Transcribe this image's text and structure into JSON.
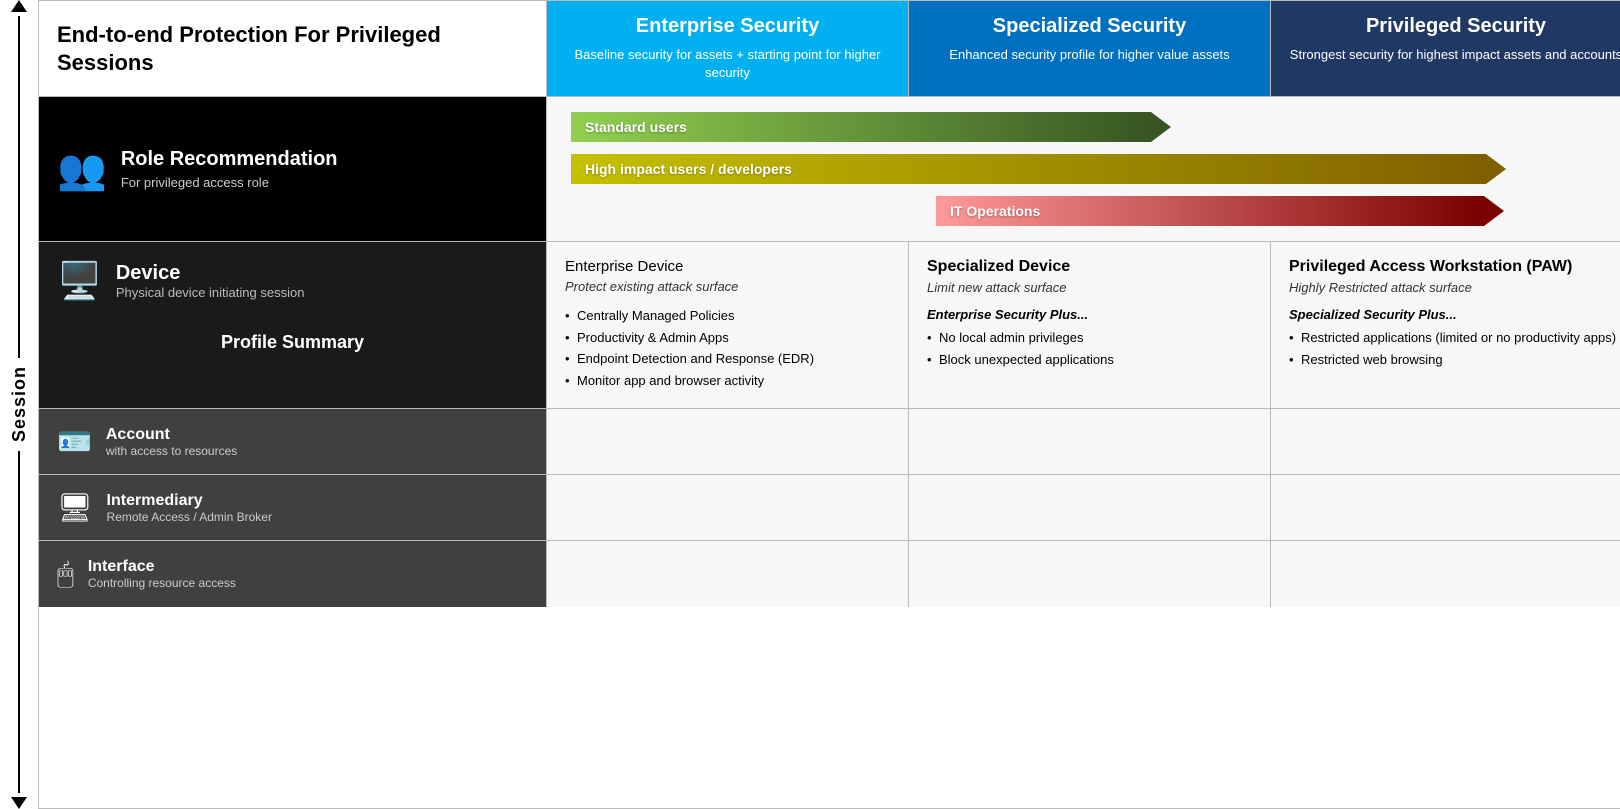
{
  "page": {
    "title": "End-to-end Protection For Privileged Sessions",
    "session_label": "Session"
  },
  "columns": {
    "enterprise": {
      "title": "Enterprise Security",
      "description": "Baseline security for assets + starting point for higher security"
    },
    "specialized": {
      "title": "Specialized Security",
      "description": "Enhanced security profile for higher value assets"
    },
    "privileged": {
      "title": "Privileged Security",
      "description": "Strongest security for highest impact assets and accounts"
    }
  },
  "role_section": {
    "title": "Role Recommendation",
    "subtitle": "For privileged access role",
    "bars": {
      "standard": "Standard users",
      "high_impact": "High impact users / developers",
      "it_ops": "IT Operations"
    }
  },
  "device_section": {
    "title": "Device",
    "subtitle": "Physical device initiating session",
    "profile_summary": "Profile Summary",
    "enterprise": {
      "title": "Enterprise Device",
      "subtitle": "Protect existing attack surface",
      "bullets": [
        "Centrally Managed Policies",
        "Productivity & Admin Apps",
        "Endpoint Detection and Response (EDR)",
        "Monitor app and browser activity"
      ]
    },
    "specialized": {
      "title": "Specialized Device",
      "subtitle": "Limit new attack surface",
      "plus_title": "Enterprise Security Plus...",
      "bullets": [
        "No local admin privileges",
        "Block unexpected applications"
      ]
    },
    "privileged": {
      "title": "Privileged Access Workstation (PAW)",
      "subtitle": "Highly Restricted attack surface",
      "plus_title": "Specialized Security Plus...",
      "bullets": [
        "Restricted applications (limited or no productivity apps)",
        "Restricted web browsing"
      ]
    }
  },
  "account_section": {
    "title": "Account",
    "subtitle": "with access to resources"
  },
  "intermediary_section": {
    "title": "Intermediary",
    "subtitle": "Remote Access / Admin Broker"
  },
  "interface_section": {
    "title": "Interface",
    "subtitle": "Controlling resource access"
  }
}
